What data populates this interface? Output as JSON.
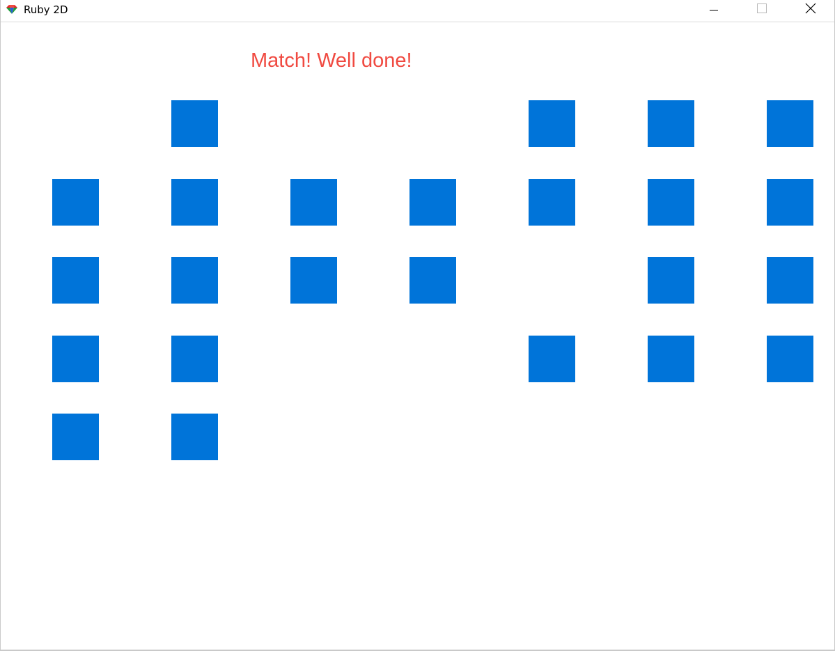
{
  "window": {
    "title": "Ruby 2D",
    "icon": "ruby2d-logo-icon",
    "controls": [
      "minimize-icon",
      "maximize-icon",
      "close-icon"
    ]
  },
  "game": {
    "message": "Match! Well done!",
    "colors": {
      "message": "#f04a41",
      "tile": "#0074d9",
      "background": "#ffffff"
    },
    "grid": {
      "columns": 7,
      "rows": 5,
      "face_down_tiles": [
        {
          "row": 0,
          "col": 1
        },
        {
          "row": 0,
          "col": 4
        },
        {
          "row": 0,
          "col": 5
        },
        {
          "row": 0,
          "col": 6
        },
        {
          "row": 1,
          "col": 0
        },
        {
          "row": 1,
          "col": 1
        },
        {
          "row": 1,
          "col": 2
        },
        {
          "row": 1,
          "col": 3
        },
        {
          "row": 1,
          "col": 4
        },
        {
          "row": 1,
          "col": 5
        },
        {
          "row": 1,
          "col": 6
        },
        {
          "row": 2,
          "col": 0
        },
        {
          "row": 2,
          "col": 1
        },
        {
          "row": 2,
          "col": 2
        },
        {
          "row": 2,
          "col": 3
        },
        {
          "row": 2,
          "col": 5
        },
        {
          "row": 2,
          "col": 6
        },
        {
          "row": 3,
          "col": 0
        },
        {
          "row": 3,
          "col": 1
        },
        {
          "row": 3,
          "col": 4
        },
        {
          "row": 3,
          "col": 5
        },
        {
          "row": 3,
          "col": 6
        },
        {
          "row": 4,
          "col": 0
        },
        {
          "row": 4,
          "col": 1
        }
      ]
    }
  }
}
